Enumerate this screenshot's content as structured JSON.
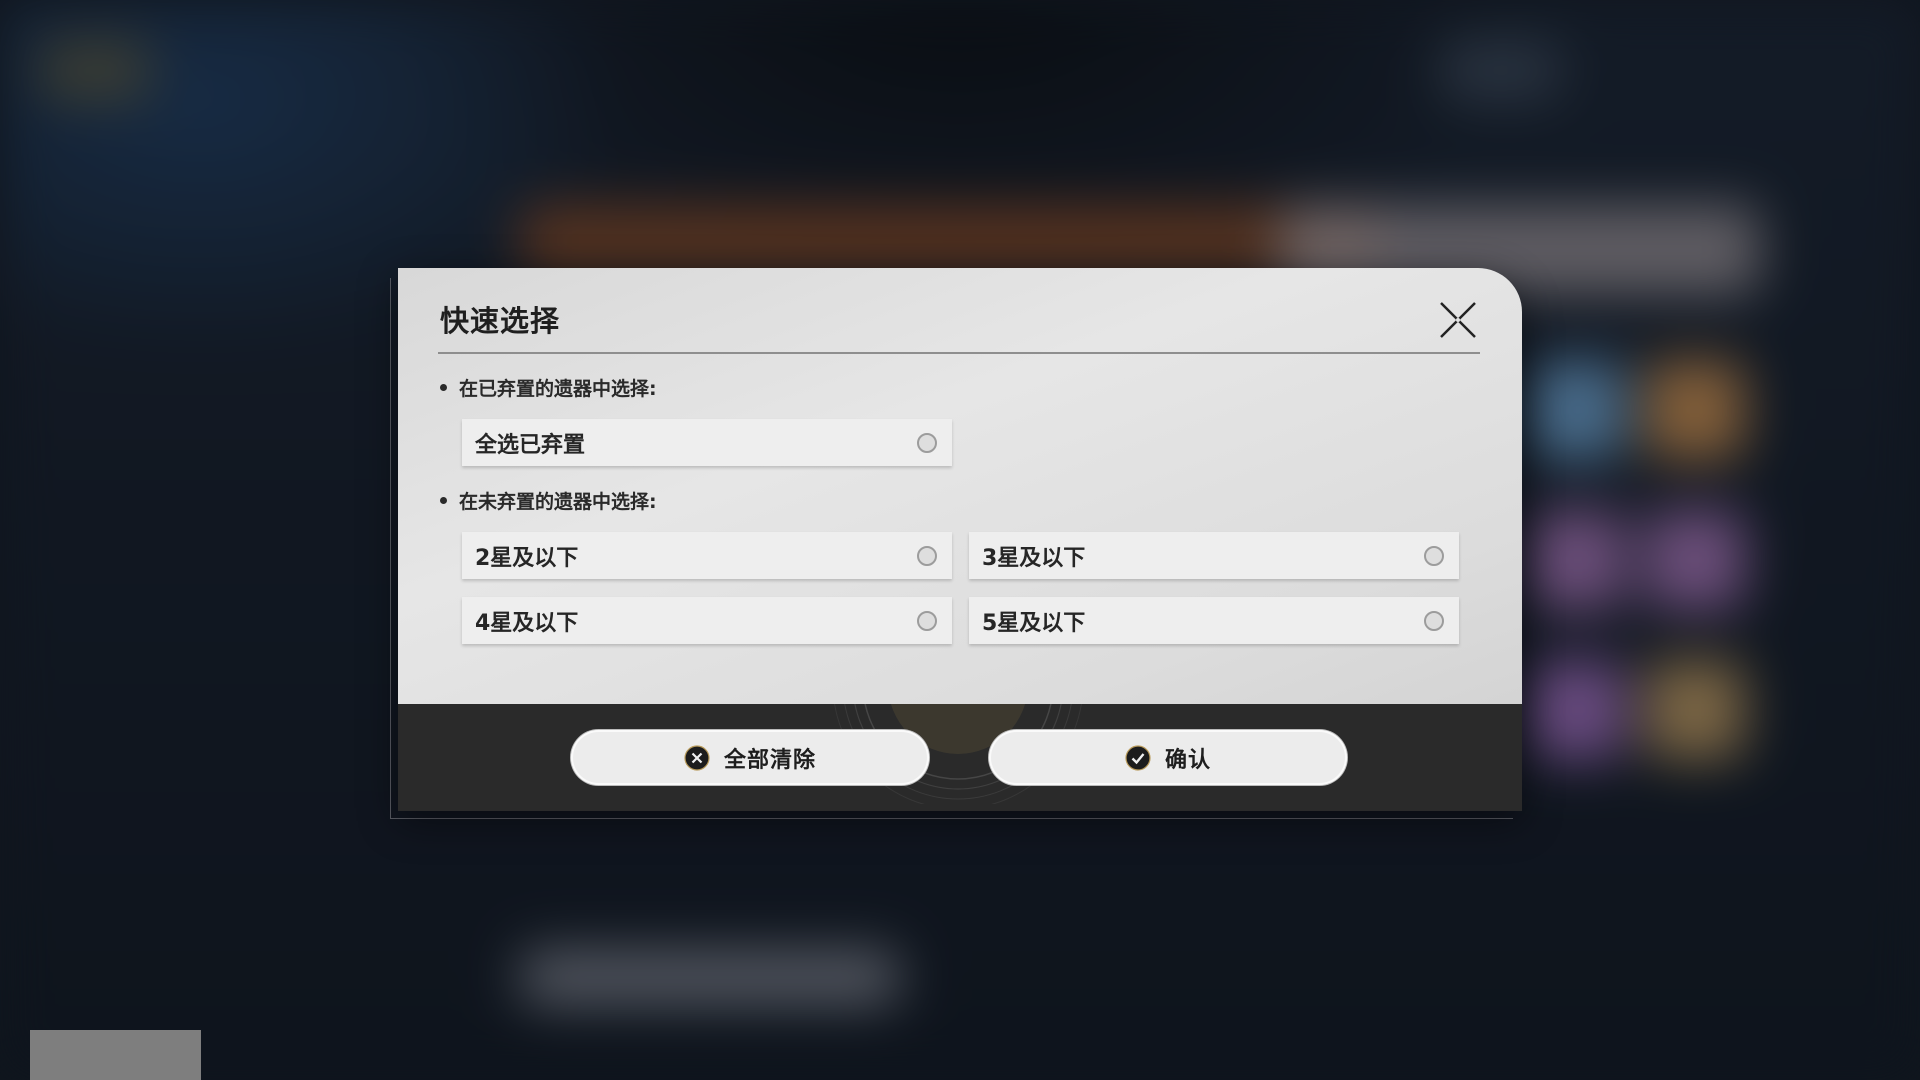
{
  "dialog": {
    "title": "快速选择",
    "close_icon": "close-icon",
    "section_discarded": {
      "label": "在已弃置的遗器中选择:",
      "options": [
        {
          "label": "全选已弃置",
          "selected": false
        }
      ]
    },
    "section_not_discarded": {
      "label": "在未弃置的遗器中选择:",
      "options": [
        {
          "label": "2星及以下",
          "selected": false
        },
        {
          "label": "3星及以下",
          "selected": false
        },
        {
          "label": "4星及以下",
          "selected": false
        },
        {
          "label": "5星及以下",
          "selected": false
        }
      ]
    },
    "footer": {
      "clear_all": {
        "label": "全部清除",
        "icon": "x-circle-icon"
      },
      "confirm": {
        "label": "确认",
        "icon": "check-circle-icon"
      }
    }
  },
  "colors": {
    "panel": "#e2e2e2",
    "footer": "#2a2a2a",
    "button": "#ececec",
    "text": "#1f1f1f"
  }
}
